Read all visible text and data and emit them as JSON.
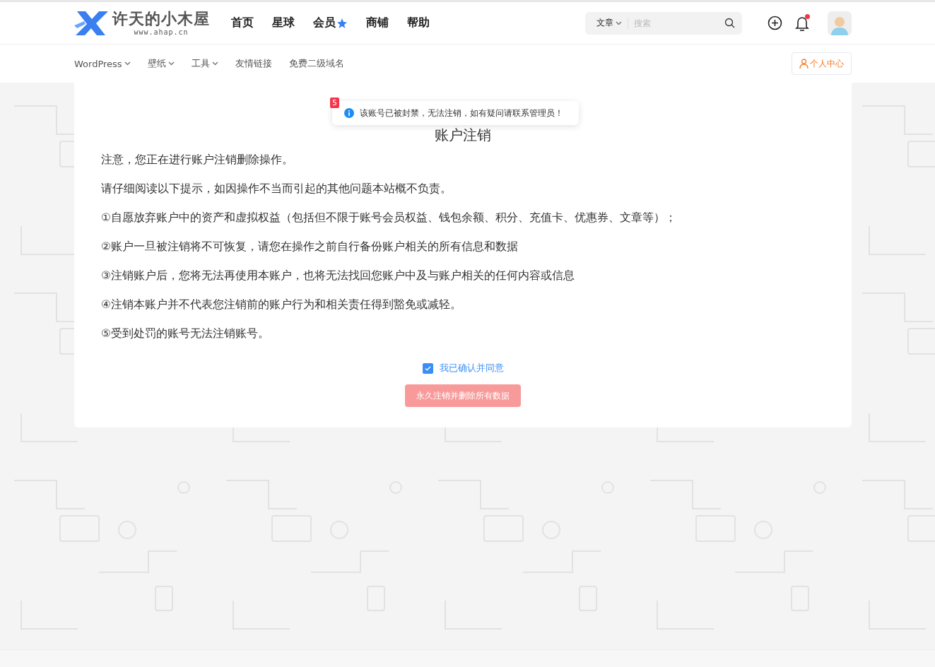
{
  "header": {
    "logo": {
      "title": "许天的小木屋",
      "subtitle": "www.ahap.cn"
    },
    "nav": [
      {
        "label": "首页",
        "star": false
      },
      {
        "label": "星球",
        "star": false
      },
      {
        "label": "会员",
        "star": true
      },
      {
        "label": "商铺",
        "star": false
      },
      {
        "label": "帮助",
        "star": false
      }
    ],
    "search": {
      "scope": "文章",
      "placeholder": "搜索"
    },
    "notifications": {
      "unread": true
    }
  },
  "subnav": {
    "items": [
      {
        "label": "WordPress",
        "dropdown": true
      },
      {
        "label": "壁纸",
        "dropdown": true
      },
      {
        "label": "工具",
        "dropdown": true
      },
      {
        "label": "友情链接",
        "dropdown": false
      },
      {
        "label": "免费二级域名",
        "dropdown": false
      }
    ],
    "user_center": "个人中心"
  },
  "toast": {
    "count": "5",
    "message": "该账号已被封禁，无法注销，如有疑问请联系管理员！"
  },
  "card": {
    "title": "账户注销",
    "paragraphs": [
      "注意，您正在进行账户注销删除操作。",
      "请仔细阅读以下提示，如因操作不当而引起的其他问题本站概不负责。",
      "①自愿放弃账户中的资产和虚拟权益（包括但不限于账号会员权益、钱包余额、积分、充值卡、优惠券、文章等）；",
      "②账户一旦被注销将不可恢复，请您在操作之前自行备份账户相关的所有信息和数据",
      "③注销账户后，您将无法再使用本账户，也将无法找回您账户中及与账户相关的任何内容或信息",
      "④注销本账户并不代表您注销前的账户行为和相关责任得到豁免或减轻。",
      "⑤受到处罚的账号无法注销账号。"
    ],
    "agree": {
      "label": "我已确认并同意",
      "checked": true
    },
    "submit": {
      "label": "永久注销并删除所有数据",
      "disabled": true
    }
  }
}
